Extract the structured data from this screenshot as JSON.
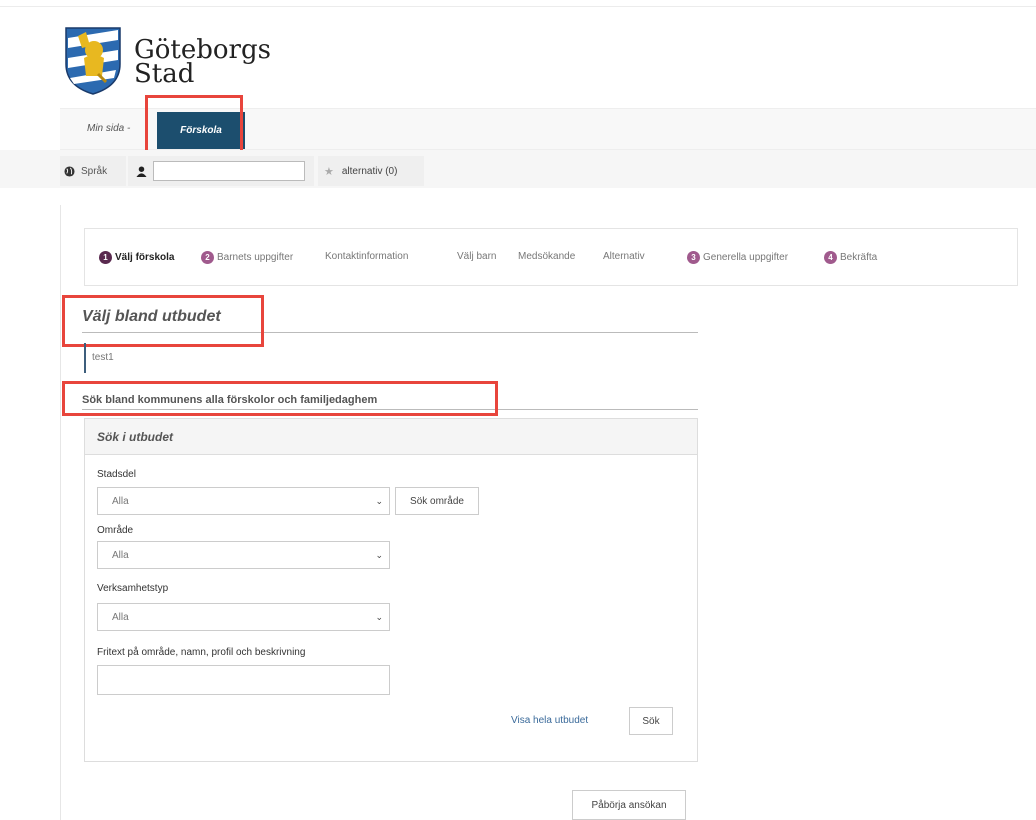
{
  "brand": {
    "line1": "Göteborgs",
    "line2": "Stad"
  },
  "nav": {
    "min_sida": "Min sida -",
    "active_tab": "Förskola"
  },
  "toolbar": {
    "language": "Språk",
    "user_value": "",
    "alternatives": "alternativ (0)"
  },
  "steps": [
    {
      "num": "1",
      "label": "Välj förskola"
    },
    {
      "num": "2",
      "label": "Barnets uppgifter"
    },
    {
      "num": "",
      "label": "Kontaktinformation"
    },
    {
      "num": "",
      "label": "Välj barn"
    },
    {
      "num": "",
      "label": "Medsökande"
    },
    {
      "num": "",
      "label": "Alternativ"
    },
    {
      "num": "3",
      "label": "Generella uppgifter"
    },
    {
      "num": "4",
      "label": "Bekräfta"
    }
  ],
  "main": {
    "heading": "Välj bland utbudet",
    "test_text": "test1",
    "sub_heading": "Sök bland kommunens alla förskolor och familjedaghem"
  },
  "search": {
    "title": "Sök i utbudet",
    "stadsdel_label": "Stadsdel",
    "stadsdel_value": "Alla",
    "sok_omrade_button": "Sök område",
    "omrade_label": "Område",
    "omrade_value": "Alla",
    "verksamhetstyp_label": "Verksamhetstyp",
    "verksamhetstyp_value": "Alla",
    "fritext_label": "Fritext på område, namn, profil och beskrivning",
    "fritext_value": "",
    "visa_link": "Visa hela utbudet",
    "sok_button": "Sök"
  },
  "footer": {
    "start_button": "Påbörja ansökan"
  },
  "colors": {
    "nav_active": "#1c4e6e",
    "step_badge": "#a05a8d",
    "highlight": "#e8453c"
  }
}
